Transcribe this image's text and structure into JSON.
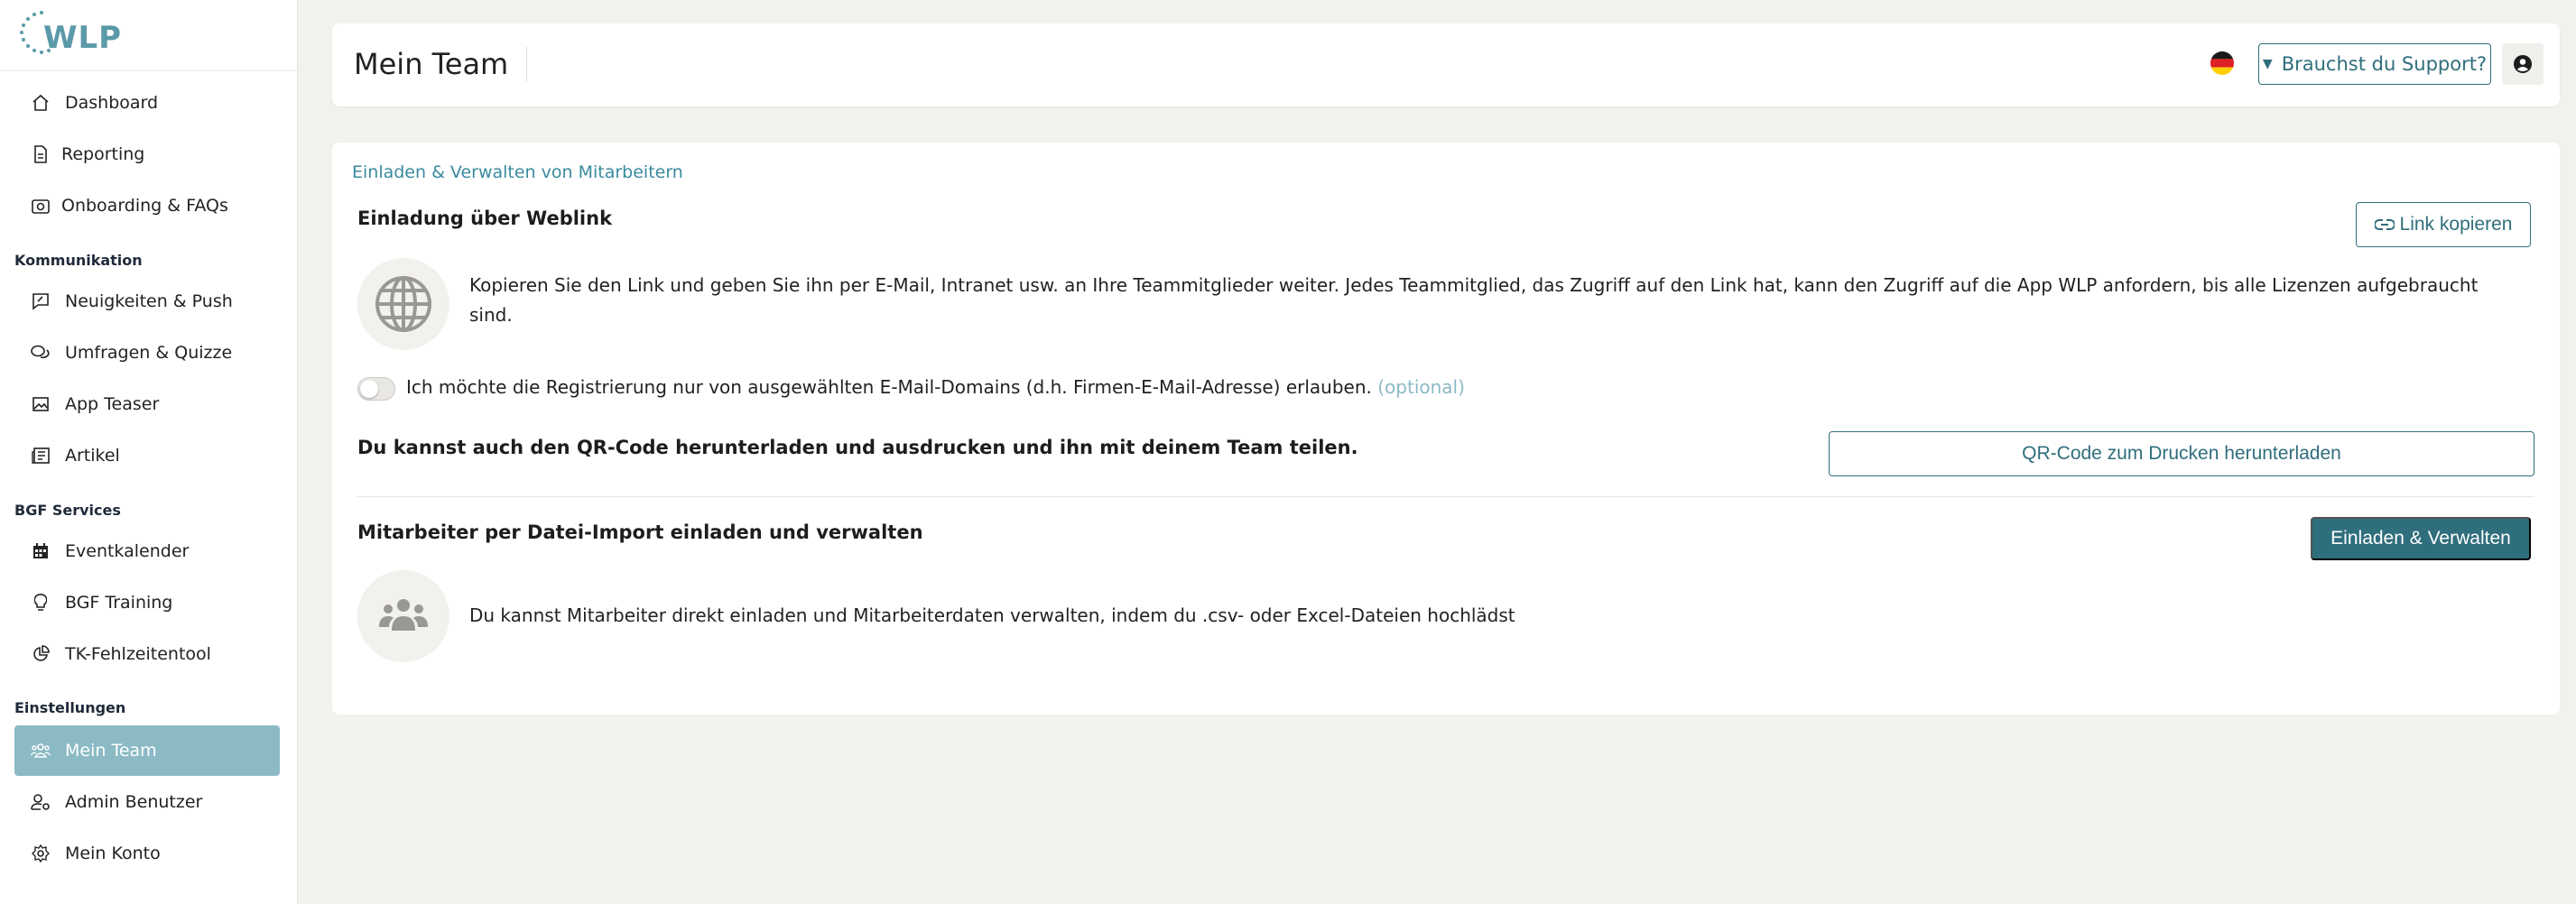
{
  "brand": {
    "logo_text": "WLP",
    "accent": "#2f6e7c",
    "active_bg": "#8bbac5"
  },
  "sidebar": {
    "items_top": [
      {
        "label": "Dashboard",
        "icon": "home-icon"
      },
      {
        "label": "Reporting",
        "icon": "document-icon"
      },
      {
        "label": "Onboarding & FAQs",
        "icon": "camera-icon"
      }
    ],
    "sections": [
      {
        "title": "Kommunikation",
        "items": [
          {
            "label": "Neuigkeiten & Push",
            "icon": "message-edit-icon"
          },
          {
            "label": "Umfragen & Quizze",
            "icon": "chat-bubbles-icon"
          },
          {
            "label": "App Teaser",
            "icon": "image-icon"
          },
          {
            "label": "Artikel",
            "icon": "newspaper-icon"
          }
        ]
      },
      {
        "title": "BGF Services",
        "items": [
          {
            "label": "Eventkalender",
            "icon": "calendar-icon"
          },
          {
            "label": "BGF Training",
            "icon": "lightbulb-icon"
          },
          {
            "label": "TK-Fehlzeitentool",
            "icon": "pie-chart-icon"
          }
        ]
      },
      {
        "title": "Einstellungen",
        "items": [
          {
            "label": "Mein Team",
            "icon": "team-icon",
            "active": true
          },
          {
            "label": "Admin Benutzer",
            "icon": "user-gear-icon"
          },
          {
            "label": "Mein Konto",
            "icon": "gear-icon"
          }
        ]
      }
    ]
  },
  "header": {
    "title": "Mein Team",
    "language_icon": "german-flag-icon",
    "support_label": "Brauchst du Support?",
    "profile_icon": "user-circle-icon"
  },
  "card": {
    "header": "Einladen & Verwalten von Mitarbeitern",
    "weblink": {
      "title": "Einladung über Weblink",
      "button": "Link kopieren",
      "description": "Kopieren Sie den Link und geben Sie ihn per E-Mail, Intranet usw. an Ihre Teammitglieder weiter. Jedes Teammitglied, das Zugriff auf den Link hat, kann den Zugriff auf die App WLP anfordern, bis alle Lizenzen aufgebraucht sind.",
      "toggle_label": "Ich möchte die Registrierung nur von ausgewählten E-Mail-Domains (d.h. Firmen-E-Mail-Adresse) erlauben.",
      "toggle_optional": "(optional)",
      "toggle_on": false
    },
    "qr": {
      "title": "Du kannst auch den QR-Code herunterladen und ausdrucken und ihn mit deinem Team teilen.",
      "button": "QR-Code zum Drucken herunterladen"
    },
    "import": {
      "title": "Mitarbeiter per Datei-Import einladen und verwalten",
      "button": "Einladen & Verwalten",
      "description": "Du kannst Mitarbeiter direkt einladen und Mitarbeiterdaten verwalten, indem du .csv- oder Excel-Dateien hochlädst"
    }
  }
}
